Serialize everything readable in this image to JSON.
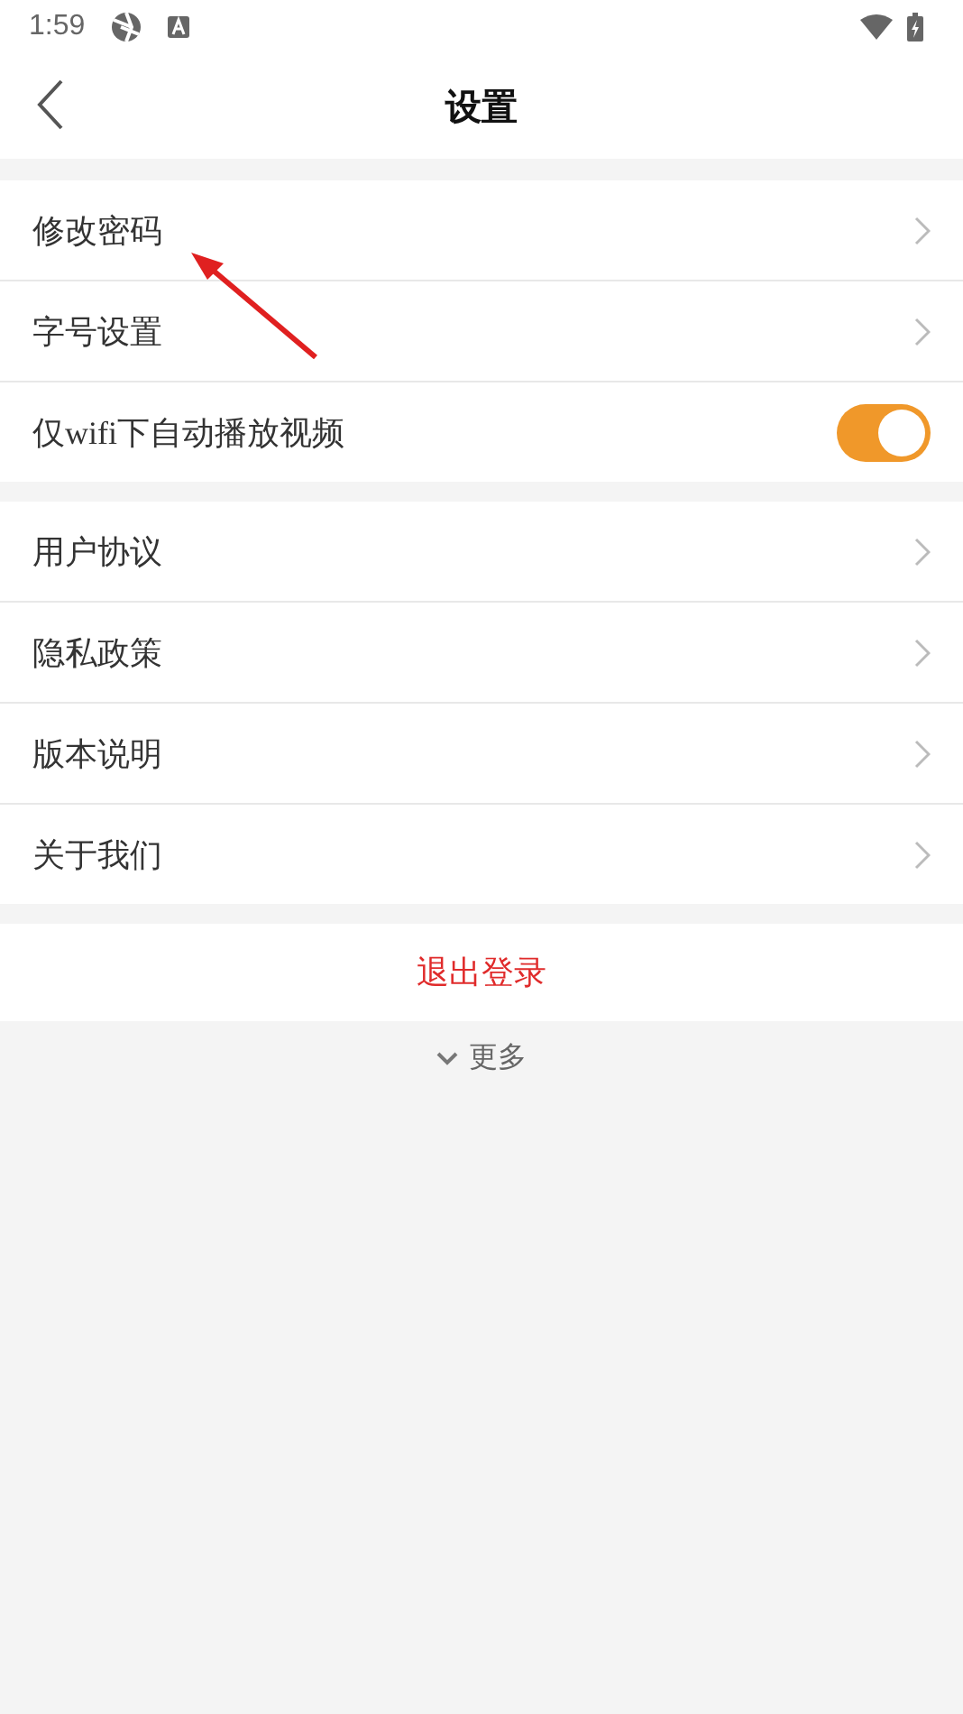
{
  "status_bar": {
    "time": "1:59"
  },
  "header": {
    "title": "设置"
  },
  "groups": [
    {
      "items": [
        {
          "label": "修改密码",
          "kind": "link"
        },
        {
          "label": "字号设置",
          "kind": "link"
        },
        {
          "label": "仅wifi下自动播放视频",
          "kind": "toggle",
          "on": true
        }
      ]
    },
    {
      "items": [
        {
          "label": "用户协议",
          "kind": "link"
        },
        {
          "label": "隐私政策",
          "kind": "link"
        },
        {
          "label": "版本说明",
          "kind": "link"
        },
        {
          "label": "关于我们",
          "kind": "link"
        }
      ]
    }
  ],
  "logout": "退出登录",
  "more": "更多"
}
